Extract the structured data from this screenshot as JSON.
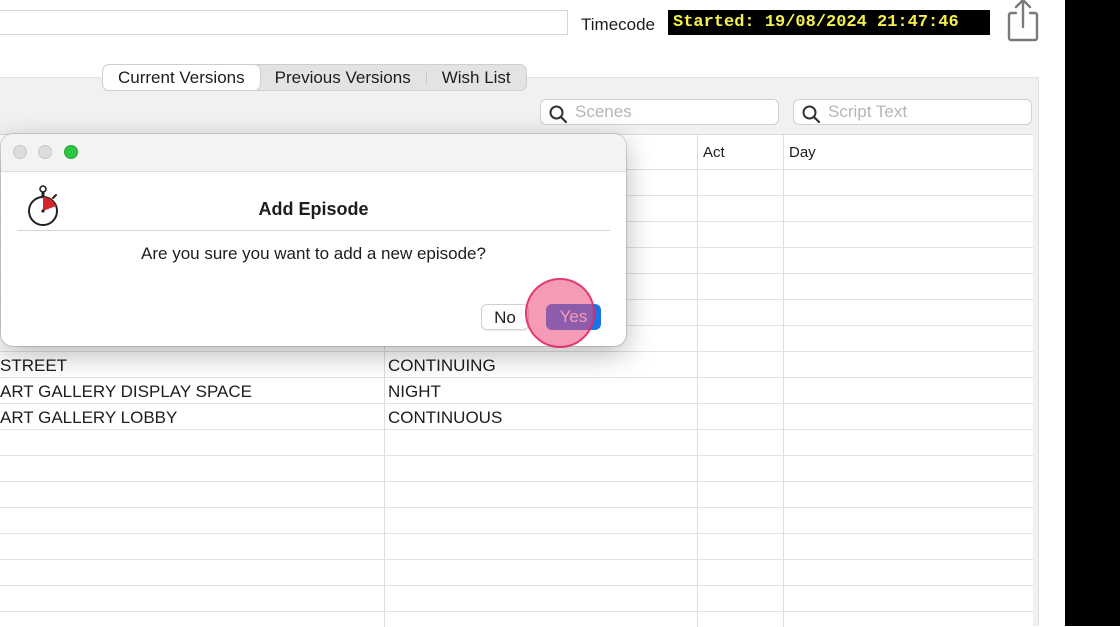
{
  "header": {
    "timecode_label": "Timecode",
    "timecode_value": "Started: 19/08/2024 21:47:46",
    "share_icon": "share-icon"
  },
  "tabs": [
    {
      "label": "Current Versions",
      "active": true
    },
    {
      "label": "Previous Versions",
      "active": false
    },
    {
      "label": "Wish List",
      "active": false
    }
  ],
  "search": {
    "scenes_placeholder": "Scenes",
    "script_placeholder": "Script Text"
  },
  "table": {
    "columns": [
      "",
      "",
      "Act",
      "Day"
    ],
    "rows": [
      {
        "location": "STREET",
        "time": "CONTINUING"
      },
      {
        "location": "ART GALLERY DISPLAY SPACE",
        "time": "NIGHT"
      },
      {
        "location": "ART GALLERY LOBBY",
        "time": "CONTINUOUS"
      }
    ]
  },
  "dialog": {
    "title": "Add Episode",
    "message": "Are you sure you want to add a new episode?",
    "no_label": "No",
    "yes_label": "Yes",
    "icon": "stopwatch-icon"
  },
  "colors": {
    "timecode_bg": "#000000",
    "timecode_fg": "#f5f04a",
    "primary_button": "#1a73e8",
    "click_indicator": "#ec4878"
  }
}
